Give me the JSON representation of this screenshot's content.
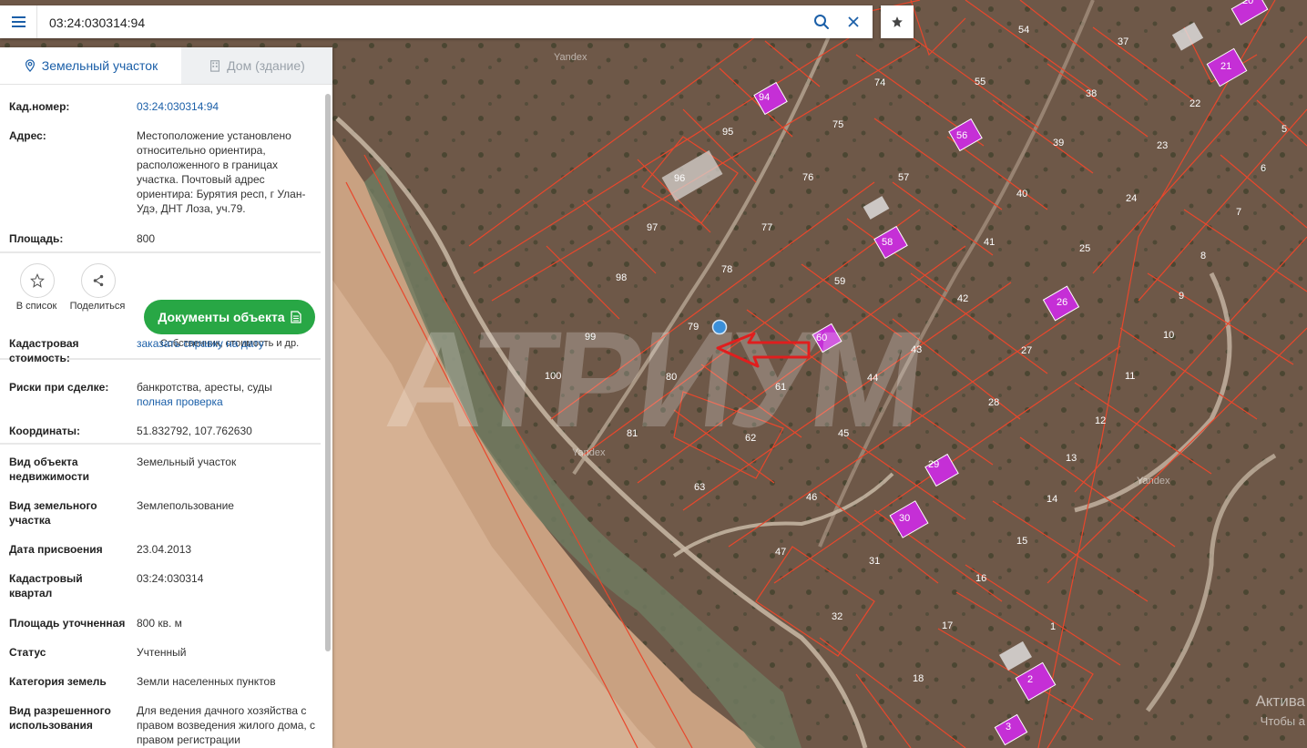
{
  "search": {
    "value": "03:24:030314:94"
  },
  "panel": {
    "tabs": [
      {
        "label": "Земельный участок"
      },
      {
        "label": "Дом (здание)"
      }
    ],
    "fields_top": [
      {
        "label": "Кад.номер:",
        "value": "03:24:030314:94"
      },
      {
        "label": "Адрес:",
        "value": "Местоположение установлено относительно ориентира, расположенного в границах участка. Почтовый адрес ориентира: Бурятия респ, г Улан-Удэ, ДНТ Лоза, уч.79."
      },
      {
        "label": "Площадь:",
        "value": "800"
      }
    ],
    "actions": {
      "add_to_list": "В список",
      "share": "Поделиться",
      "documents": "Документы объекта",
      "documents_caption": "Собственник, стоимость и др."
    },
    "fields_mid": [
      {
        "label": "Кадастровая стоимость:",
        "value": "заказать справку на дату"
      },
      {
        "label": "Риски при сделке:",
        "value": "банкротства, аресты, суды",
        "link": "полная проверка"
      },
      {
        "label": "Координаты:",
        "value": "51.832792, 107.762630"
      }
    ],
    "fields_bottom": [
      {
        "label": "Вид объекта недвижимости",
        "value": "Земельный участок"
      },
      {
        "label": "Вид земельного участка",
        "value": "Землепользование"
      },
      {
        "label": "Дата присвоения",
        "value": "23.04.2013"
      },
      {
        "label": "Кадастровый квартал",
        "value": "03:24:030314"
      },
      {
        "label": "Площадь уточненная",
        "value": "800 кв. м"
      },
      {
        "label": "Статус",
        "value": "Учтенный"
      },
      {
        "label": "Категория земель",
        "value": "Земли населенных пунктов"
      },
      {
        "label": "Вид разрешенного использования",
        "value": "Для ведения дачного хозяйства с правом возведения жилого дома, с правом регистрации"
      }
    ]
  },
  "map": {
    "watermark": "АТРИУМ",
    "yandex_label": "Yandex",
    "activation_title": "Актива",
    "activation_sub": "Чтобы а",
    "plot_numbers": [
      "54",
      "37",
      "74",
      "55",
      "38",
      "22",
      "94",
      "95",
      "75",
      "56",
      "39",
      "23",
      "5",
      "96",
      "76",
      "57",
      "6",
      "24",
      "40",
      "97",
      "77",
      "58",
      "41",
      "25",
      "7",
      "98",
      "78",
      "59",
      "42",
      "26",
      "8",
      "9",
      "79",
      "99",
      "60",
      "43",
      "27",
      "10",
      "100",
      "80",
      "61",
      "44",
      "28",
      "11",
      "81",
      "62",
      "45",
      "12",
      "29",
      "13",
      "63",
      "46",
      "14",
      "30",
      "15",
      "47",
      "31",
      "16",
      "32",
      "17",
      "1",
      "18",
      "2",
      "3",
      "21",
      "20"
    ],
    "houses": [
      "94",
      "96",
      "56",
      "58",
      "26",
      "60",
      "29",
      "30",
      "2",
      "3",
      "21"
    ]
  }
}
